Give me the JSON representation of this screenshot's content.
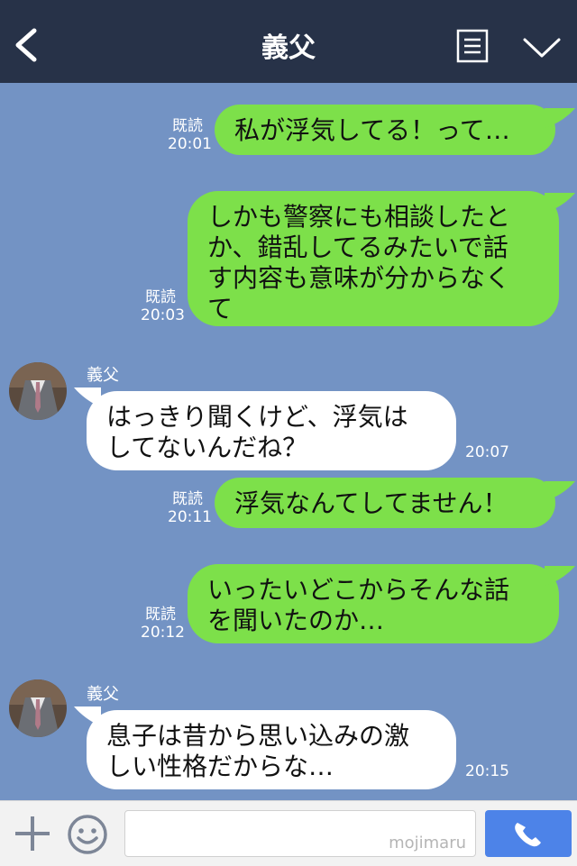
{
  "header": {
    "title": "義父"
  },
  "messages": [
    {
      "side": "right",
      "read": "既読",
      "time": "20:01",
      "text": "私が浮気してる！って…"
    },
    {
      "side": "right",
      "read": "既読",
      "time": "20:03",
      "lines": [
        "しかも警察にも相談したと",
        "か、錯乱してるみたいで話",
        "す内容も意味が分からなく",
        "て"
      ]
    },
    {
      "side": "left",
      "sender": "義父",
      "time": "20:07",
      "lines": [
        "はっきり聞くけど、浮気は",
        "してないんだね？"
      ]
    },
    {
      "side": "right",
      "read": "既読",
      "time": "20:11",
      "text": "浮気なんてしてません！"
    },
    {
      "side": "right",
      "read": "既読",
      "time": "20:12",
      "lines": [
        "いったいどこからそんな話",
        "を聞いたのか…"
      ]
    },
    {
      "side": "left",
      "sender": "義父",
      "time": "20:15",
      "lines": [
        "息子は昔から思い込みの激",
        "しい性格だからな…"
      ]
    }
  ],
  "footer": {
    "watermark": "mojimaru"
  },
  "icons": [
    "back-icon",
    "memo-icon",
    "chevron-down-icon",
    "plus-icon",
    "smile-icon",
    "phone-icon"
  ],
  "colors": {
    "header": "#273248",
    "background": "#7393c4",
    "sent_bubble": "#7de04a",
    "received_bubble": "#ffffff",
    "call_button": "#4d83e8"
  }
}
